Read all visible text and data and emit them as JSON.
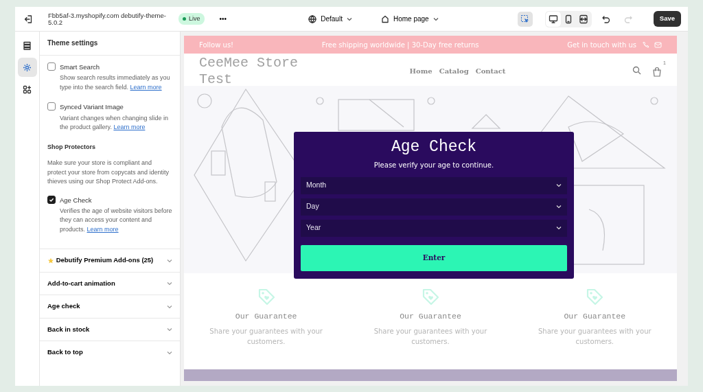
{
  "topbar": {
    "title": "Fbb5af-3.myshopify.com debutify-theme-5.0.2",
    "status": "Live",
    "more": "•••",
    "theme_selector": "Default",
    "page_selector": "Home page",
    "tools": [
      {
        "kind": "inspect",
        "selected": true
      },
      {
        "kind": "desktop",
        "selected": true
      },
      {
        "kind": "mobile",
        "selected": false
      },
      {
        "kind": "fullwidth",
        "selected": false
      }
    ],
    "redo_disabled": true,
    "save": "Save"
  },
  "rail": [
    {
      "kind": "sections",
      "selected": false
    },
    {
      "kind": "settings",
      "selected": true
    },
    {
      "kind": "apps",
      "selected": false
    }
  ],
  "panel": {
    "title": "Theme settings",
    "settings": [
      {
        "kind": "checkbox",
        "label": "Smart Search",
        "checked": false,
        "text": "Show search results immediately as you type into the search field.",
        "link": "Learn more"
      },
      {
        "kind": "checkbox",
        "label": "Synced Variant Image",
        "checked": false,
        "text": "Variant changes when changing slide in the product gallery.",
        "link": "Learn more"
      },
      {
        "kind": "heading",
        "label": "Shop Protectors"
      },
      {
        "kind": "paragraph",
        "text": "Make sure your store is compliant and protect your store from copycats and identity thieves using our Shop Protect Add-ons."
      },
      {
        "kind": "checkbox",
        "label": "Age Check",
        "checked": true,
        "text": "Verifies the age of website visitors before they can access your content and products.",
        "link": "Learn more"
      }
    ],
    "sections": [
      {
        "label": "Debutify Premium Add-ons (25)",
        "star": true
      },
      {
        "label": "Add-to-cart animation",
        "star": false
      },
      {
        "label": "Age check",
        "star": false
      },
      {
        "label": "Back in stock",
        "star": false
      },
      {
        "label": "Back to top",
        "star": false
      }
    ]
  },
  "preview": {
    "announcement": {
      "left": "Follow us!",
      "center": "Free shipping worldwide | 30-Day free returns",
      "right": "Get in touch with us"
    },
    "logo": "CeeMee Store Test",
    "nav": [
      "Home",
      "Catalog",
      "Contact"
    ],
    "cart_count": "1",
    "modal": {
      "title": "Age Check",
      "subtitle": "Please verify your age to continue.",
      "selects": [
        "Month",
        "Day",
        "Year"
      ],
      "button": "Enter"
    },
    "features": [
      {
        "title": "Our Guarantee",
        "text": "Share your guarantees with your customers."
      },
      {
        "title": "Our Guarantee",
        "text": "Share your guarantees with your customers."
      },
      {
        "title": "Our Guarantee",
        "text": "Share your guarantees with your customers."
      }
    ]
  }
}
